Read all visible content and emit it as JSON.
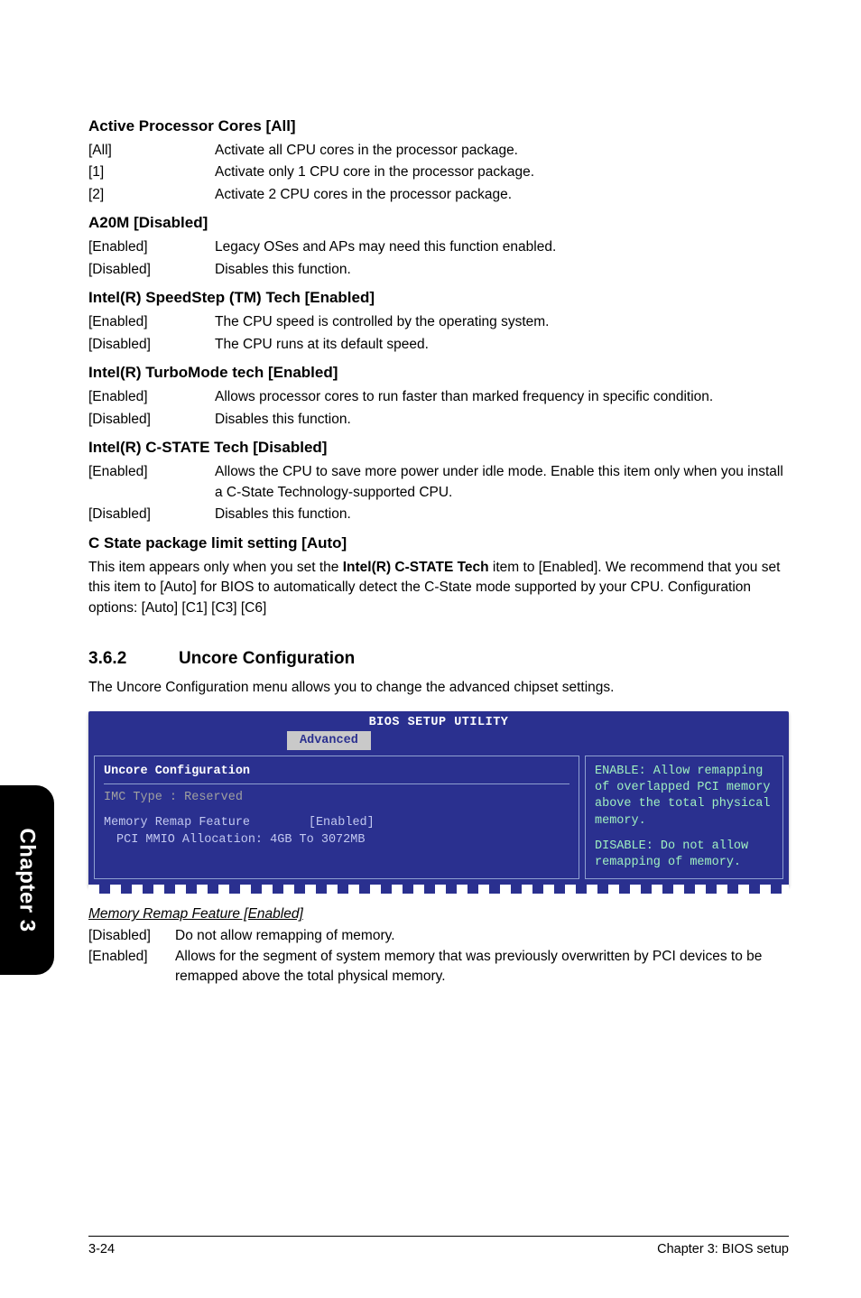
{
  "sidebar": {
    "label": "Chapter 3"
  },
  "s1": {
    "title": "Active Processor Cores [All]",
    "rows": [
      {
        "k": "[All]",
        "v": "Activate all CPU cores in the processor package."
      },
      {
        "k": "[1]",
        "v": "Activate only 1 CPU core in the processor package."
      },
      {
        "k": "[2]",
        "v": "Activate 2 CPU cores in the processor package."
      }
    ]
  },
  "s2": {
    "title": "A20M [Disabled]",
    "rows": [
      {
        "k": "[Enabled]",
        "v": "Legacy OSes and APs may need this function enabled."
      },
      {
        "k": "[Disabled]",
        "v": "Disables this function."
      }
    ]
  },
  "s3": {
    "title": "Intel(R) SpeedStep (TM) Tech [Enabled]",
    "rows": [
      {
        "k": "[Enabled]",
        "v": "The CPU speed is controlled by the operating system."
      },
      {
        "k": "[Disabled]",
        "v": "The CPU runs at its default speed."
      }
    ]
  },
  "s4": {
    "title": "Intel(R) TurboMode tech [Enabled]",
    "rows": [
      {
        "k": "[Enabled]",
        "v": "Allows processor cores to run faster than marked frequency in specific condition."
      },
      {
        "k": "[Disabled]",
        "v": "Disables this function."
      }
    ]
  },
  "s5": {
    "title": "Intel(R) C-STATE Tech [Disabled]",
    "rows": [
      {
        "k": "[Enabled]",
        "v": "Allows the CPU to save more power under idle mode. Enable this item only when you install a C-State Technology-supported CPU."
      },
      {
        "k": "[Disabled]",
        "v": "Disables this function."
      }
    ]
  },
  "s6": {
    "title": "C State package limit setting [Auto]",
    "para_parts": {
      "a": "This item appears only when you set the ",
      "b": "Intel(R) C-STATE Tech",
      "c": " item to [Enabled]. We recommend that you set this item to [Auto] for BIOS to automatically detect the C-State mode supported by your CPU. Configuration options: [Auto] [C1] [C3] [C6]"
    }
  },
  "section": {
    "num": "3.6.2",
    "title": "Uncore Configuration",
    "intro": "The Uncore Configuration menu allows you to change the advanced chipset settings."
  },
  "bios": {
    "title": "BIOS SETUP UTILITY",
    "tab": "Advanced",
    "left_header": "Uncore Configuration",
    "imc_line": "IMC Type : Reserved",
    "mrf_label": "Memory Remap Feature",
    "mrf_value": "[Enabled]",
    "pci_line": "PCI MMIO Allocation: 4GB To 3072MB",
    "help1": "ENABLE: Allow remapping of overlapped PCI memory above the total physical memory.",
    "help2": "DISABLE: Do not allow remapping of memory."
  },
  "mrf": {
    "title": "Memory Remap Feature [Enabled]",
    "rows": [
      {
        "k": "[Disabled]",
        "v": "Do not allow remapping of memory."
      },
      {
        "k": "[Enabled]",
        "v": "Allows for the segment of system memory that was previously overwritten by PCI devices to be remapped above the total physical memory."
      }
    ]
  },
  "footer": {
    "left": "3-24",
    "right": "Chapter 3: BIOS setup"
  }
}
